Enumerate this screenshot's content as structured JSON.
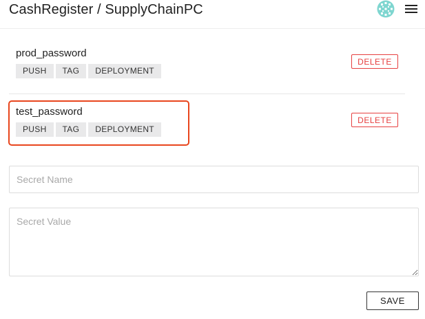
{
  "header": {
    "title": "CashRegister / SupplyChainPC",
    "avatar_icon": "identicon-avatar",
    "menu_icon": "hamburger-menu-icon",
    "avatar_color": "#7fd6d0"
  },
  "secrets": [
    {
      "name": "prod_password",
      "events": [
        "PUSH",
        "TAG",
        "DEPLOYMENT"
      ],
      "delete_label": "DELETE"
    },
    {
      "name": "test_password",
      "events": [
        "PUSH",
        "TAG",
        "DEPLOYMENT"
      ],
      "delete_label": "DELETE",
      "highlighted": true
    }
  ],
  "form": {
    "name_placeholder": "Secret Name",
    "name_value": "",
    "value_placeholder": "Secret Value",
    "value_value": "",
    "save_label": "SAVE"
  },
  "colors": {
    "delete": "#e63e3e",
    "highlight": "#e8451c",
    "chip_bg": "#e9e9ea"
  }
}
